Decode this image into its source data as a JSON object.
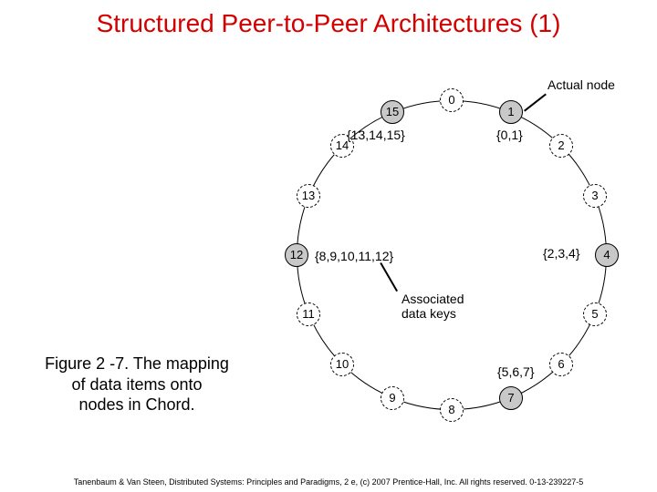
{
  "title": "Structured Peer-to-Peer Architectures (1)",
  "caption_l1": "Figure 2 -7. The mapping",
  "caption_l2": "of data items onto",
  "caption_l3": "nodes in Chord.",
  "footer": "Tanenbaum & Van Steen, Distributed Systems: Principles and Paradigms, 2 e, (c) 2007 Prentice-Hall, Inc. All rights reserved. 0-13-239227-5",
  "annot_actual": "Actual node",
  "annot_keys_l1": "Associated",
  "annot_keys_l2": "data keys",
  "nodes": {
    "n0": "0",
    "n1": "1",
    "n2": "2",
    "n3": "3",
    "n4": "4",
    "n5": "5",
    "n6": "6",
    "n7": "7",
    "n8": "8",
    "n9": "9",
    "n10": "10",
    "n11": "11",
    "n12": "12",
    "n13": "13",
    "n14": "14",
    "n15": "15"
  },
  "keys": {
    "k1": "{0,1}",
    "k4": "{2,3,4}",
    "k7": "{5,6,7}",
    "k12": "{8,9,10,11,12}",
    "k15": "{13,14,15}"
  },
  "chart_data": {
    "type": "diagram",
    "title": "Chord ring, 16-node identifier space",
    "ring_size": 16,
    "actual_nodes": [
      1,
      4,
      7,
      12,
      15
    ],
    "key_assignment": {
      "1": [
        0,
        1
      ],
      "4": [
        2,
        3,
        4
      ],
      "7": [
        5,
        6,
        7
      ],
      "12": [
        8,
        9,
        10,
        11,
        12
      ],
      "15": [
        13,
        14,
        15
      ]
    }
  }
}
